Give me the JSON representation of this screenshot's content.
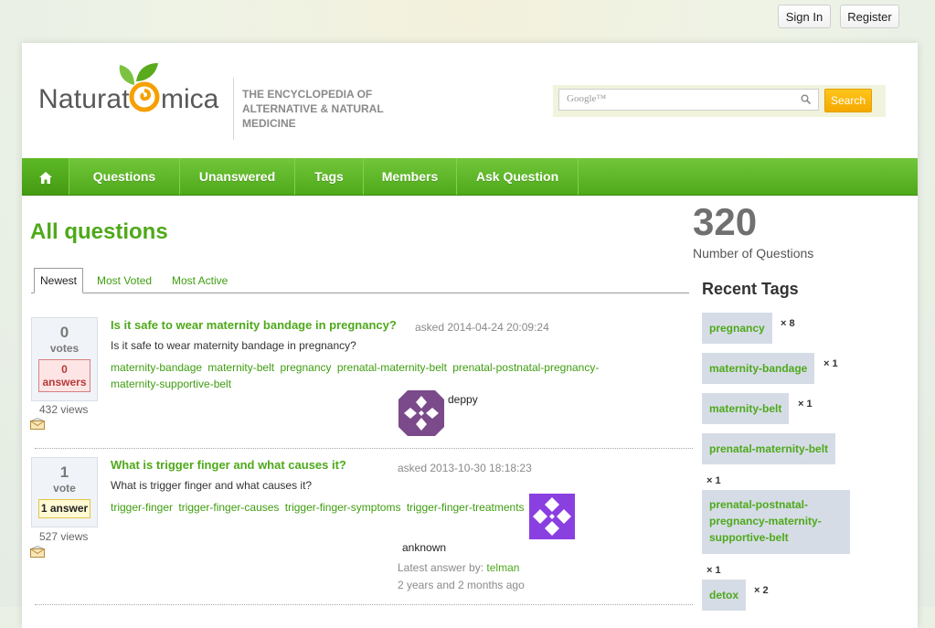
{
  "auth": {
    "sign_in": "Sign In",
    "register": "Register"
  },
  "brand": {
    "logo_left": "Naturat",
    "logo_right": "mica",
    "tagline": "THE ENCYCLOPEDIA OF ALTERNATIVE & NATURAL MEDICINE"
  },
  "search": {
    "placeholder": "Google™",
    "button": "Search"
  },
  "nav": {
    "home_icon": "home-icon",
    "items": [
      "Questions",
      "Unanswered",
      "Tags",
      "Members",
      "Ask Question"
    ]
  },
  "main": {
    "title": "All questions",
    "tabs": [
      "Newest",
      "Most Voted",
      "Most Active"
    ],
    "questions": [
      {
        "votes": "0",
        "votes_label": "votes",
        "answers": "0",
        "answers_label": "answers",
        "views": "432 views",
        "title": "Is it safe to wear maternity bandage in pregnancy?",
        "asked": "asked 2014-04-24 20:09:24",
        "excerpt": "Is it safe to wear maternity bandage in pregnancy?",
        "tags": [
          "maternity-bandage",
          "maternity-belt",
          "pregnancy",
          "prenatal-maternity-belt",
          "prenatal-postnatal-pregnancy-maternity-supportive-belt"
        ],
        "user": "deppy"
      },
      {
        "votes": "1",
        "votes_label": "vote",
        "answers_text": "1 answer",
        "views": "527 views",
        "title": "What is trigger finger and what causes it?",
        "asked": "asked 2013-10-30 18:18:23",
        "excerpt": "What is trigger finger and what causes it?",
        "tags": [
          "trigger-finger",
          "trigger-finger-causes",
          "trigger-finger-symptoms",
          "trigger-finger-treatments"
        ],
        "user": "anknown",
        "latest_label": "Latest answer by:",
        "latest_user": "telman",
        "latest_time": "2 years and 2 months ago"
      }
    ]
  },
  "sidebar": {
    "count": "320",
    "count_label": "Number of Questions",
    "recent_tags_title": "Recent Tags",
    "tags": [
      {
        "name": "pregnancy",
        "count": "× 8"
      },
      {
        "name": "maternity-bandage",
        "count": "× 1"
      },
      {
        "name": "maternity-belt",
        "count": "× 1"
      },
      {
        "name": "prenatal-maternity-belt",
        "count": "× 1"
      },
      {
        "name": "prenatal-postnatal-pregnancy-maternity-supportive-belt",
        "count": "× 1"
      },
      {
        "name": "detox",
        "count": "× 2"
      }
    ]
  },
  "colors": {
    "green": "#4ea91a",
    "orange": "#f5a800",
    "avatar": "#7a4a8a"
  }
}
